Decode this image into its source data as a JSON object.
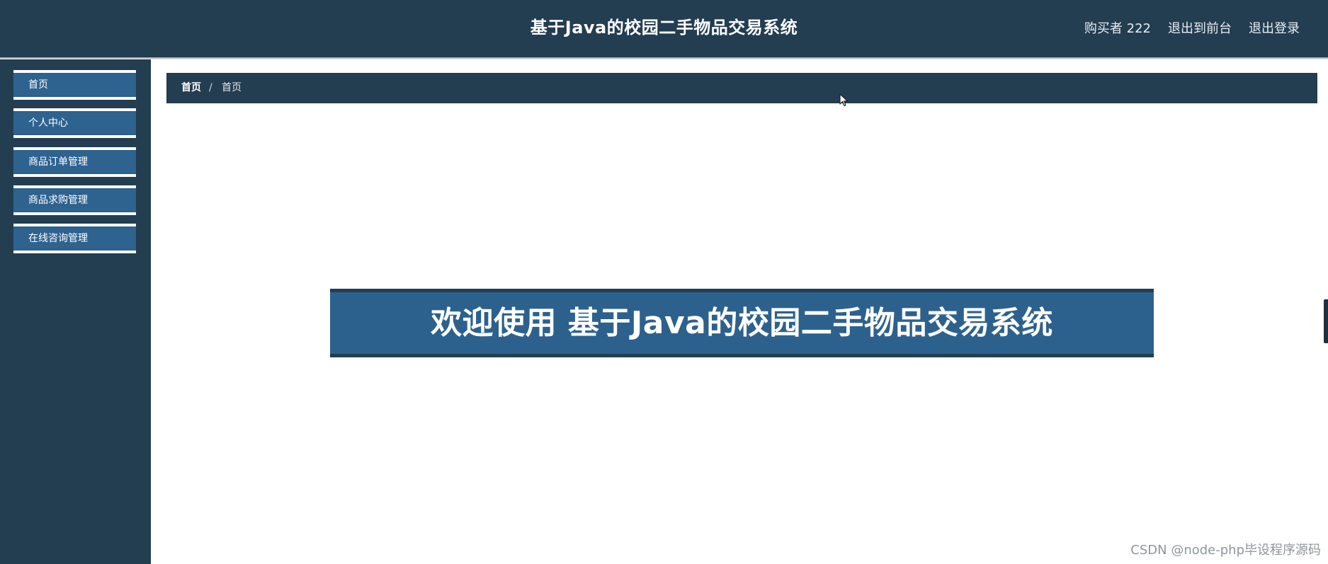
{
  "header": {
    "title": "基于Java的校园二手物品交易系统",
    "links": [
      "购买者 222",
      "退出到前台",
      "退出登录"
    ]
  },
  "sidebar": {
    "items": [
      {
        "label": "首页"
      },
      {
        "label": "个人中心"
      },
      {
        "label": "商品订单管理"
      },
      {
        "label": "商品求购管理"
      },
      {
        "label": "在线咨询管理"
      }
    ]
  },
  "breadcrumb": {
    "root": "首页",
    "separator": "/",
    "current": "首页"
  },
  "main": {
    "welcome_text": "欢迎使用 基于Java的校园二手物品交易系统"
  },
  "watermark": "CSDN @node-php毕设程序源码",
  "colors": {
    "header_bg": "#233d51",
    "accent_blue": "#2d618d",
    "page_bg": "#ffffff"
  }
}
